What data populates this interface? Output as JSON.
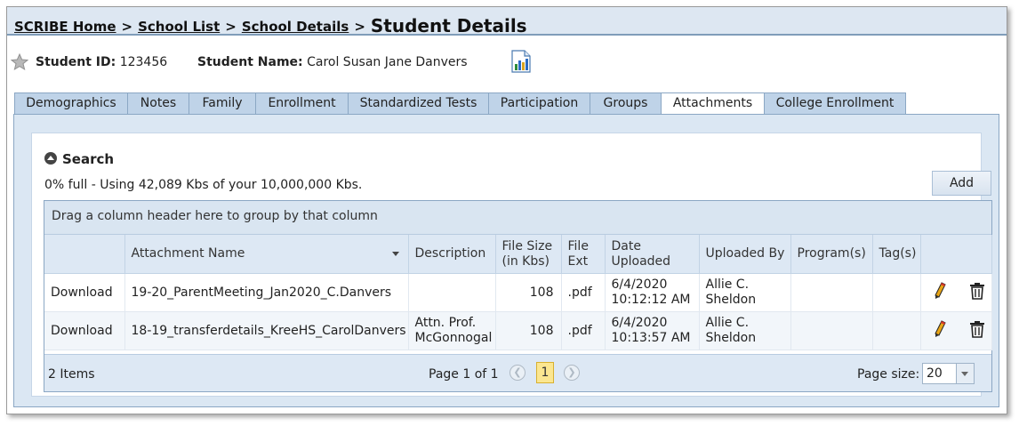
{
  "breadcrumb": {
    "home": "SCRIBE Home",
    "school_list": "School List",
    "school_details": "School Details",
    "separator": ">",
    "current": "Student Details"
  },
  "student": {
    "id_label": "Student ID:",
    "id_value": "123456",
    "name_label": "Student Name:",
    "name_value": "Carol Susan Jane Danvers"
  },
  "tabs": [
    {
      "label": "Demographics",
      "active": false
    },
    {
      "label": "Notes",
      "active": false
    },
    {
      "label": "Family",
      "active": false
    },
    {
      "label": "Enrollment",
      "active": false
    },
    {
      "label": "Standardized Tests",
      "active": false
    },
    {
      "label": "Participation",
      "active": false
    },
    {
      "label": "Groups",
      "active": false
    },
    {
      "label": "Attachments",
      "active": true
    },
    {
      "label": "College Enrollment",
      "active": false
    }
  ],
  "search": {
    "label": "Search"
  },
  "usage_text": "0% full - Using 42,089 Kbs of your 10,000,000 Kbs.",
  "add_label": "Add",
  "grid": {
    "group_hint": "Drag a column header here to group by that column",
    "columns": {
      "action": "",
      "name": "Attachment Name",
      "description": "Description",
      "size_line1": "File Size",
      "size_line2": "(in Kbs)",
      "ext_line1": "File",
      "ext_line2": "Ext",
      "date_line1": "Date",
      "date_line2": "Uploaded",
      "uploaded_by": "Uploaded By",
      "programs": "Program(s)",
      "tags": "Tag(s)"
    },
    "rows": [
      {
        "action": "Download",
        "name": "19-20_ParentMeeting_Jan2020_C.Danvers",
        "desc1": "",
        "desc2": "",
        "size": "108",
        "ext": ".pdf",
        "date1": "6/4/2020",
        "date2": "10:12:12 AM",
        "by1": "Allie C.",
        "by2": "Sheldon",
        "programs": "",
        "tags": ""
      },
      {
        "action": "Download",
        "name": "18-19_transferdetails_KreeHS_CarolDanvers",
        "desc1": "Attn. Prof.",
        "desc2": "McGonnogal",
        "size": "108",
        "ext": ".pdf",
        "date1": "6/4/2020",
        "date2": "10:13:57 AM",
        "by1": "Allie C.",
        "by2": "Sheldon",
        "programs": "",
        "tags": ""
      }
    ]
  },
  "pager": {
    "items": "2 Items",
    "page_text": "Page 1 of 1",
    "current_page": "1",
    "page_size_label": "Page size:",
    "page_size": "20"
  },
  "icons": {
    "star": "star-icon",
    "report": "report-icon",
    "edit": "pencil-icon",
    "delete": "trash-icon"
  }
}
